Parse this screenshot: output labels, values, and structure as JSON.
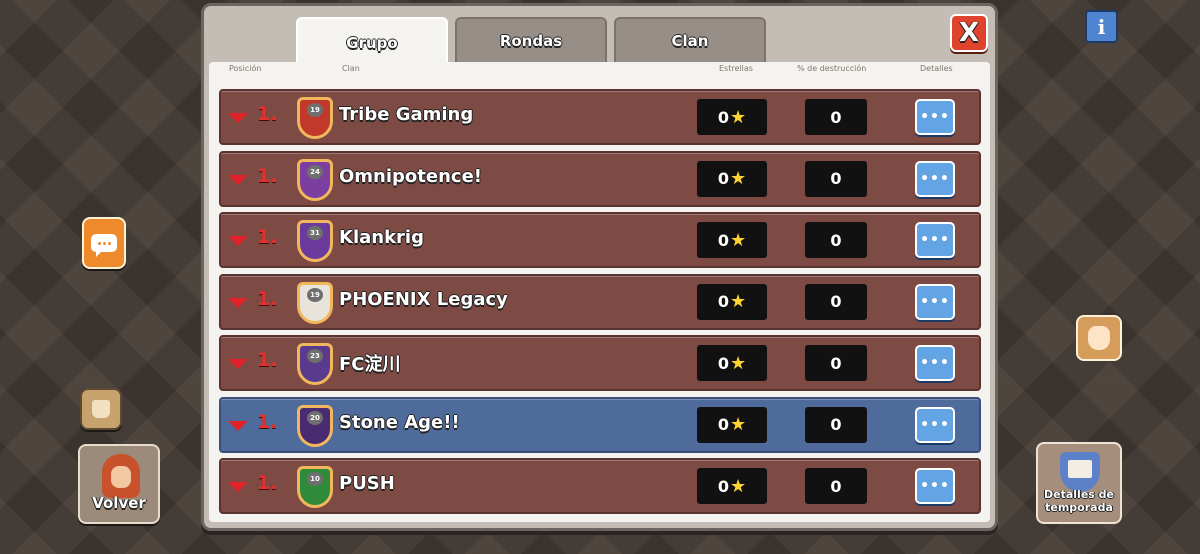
{
  "tabs": [
    {
      "label": "Grupo",
      "active": true
    },
    {
      "label": "Rondas",
      "active": false
    },
    {
      "label": "Clan",
      "active": false
    }
  ],
  "close_label": "X",
  "columns": {
    "position": "Posición",
    "clan": "Clan",
    "stars": "Estrellas",
    "destruction": "% de destrucción",
    "details": "Detalles"
  },
  "rows": [
    {
      "rank": "1.",
      "badge_level": "19",
      "name": "Tribe Gaming",
      "stars": "0",
      "destruction": "0",
      "details": "•••",
      "badge_color": "#c0392b"
    },
    {
      "rank": "1.",
      "badge_level": "24",
      "name": "Omnipotence!",
      "stars": "0",
      "destruction": "0",
      "details": "•••",
      "badge_color": "#7b3fa0"
    },
    {
      "rank": "1.",
      "badge_level": "31",
      "name": "Klankrig",
      "stars": "0",
      "destruction": "0",
      "details": "•••",
      "badge_color": "#6a3a9c"
    },
    {
      "rank": "1.",
      "badge_level": "19",
      "name": "PHOENIX Legacy",
      "stars": "0",
      "destruction": "0",
      "details": "•••",
      "badge_color": "#e8e4dc"
    },
    {
      "rank": "1.",
      "badge_level": "23",
      "name": "FC淀川",
      "stars": "0",
      "destruction": "0",
      "details": "•••",
      "badge_color": "#5a3a8c"
    },
    {
      "rank": "1.",
      "badge_level": "20",
      "name": "Stone Age!!",
      "stars": "0",
      "destruction": "0",
      "details": "•••",
      "badge_color": "#4a2a70",
      "highlight": true
    },
    {
      "rank": "1.",
      "badge_level": "10",
      "name": "PUSH",
      "stars": "0",
      "destruction": "0",
      "details": "•••",
      "badge_color": "#2f8a3a"
    }
  ],
  "side": {
    "back_label": "Volver",
    "season_label": "Detalles de temporada",
    "info_label": "i"
  },
  "colors": {
    "row_bg": "#7e4a44",
    "row_highlight_bg": "#4f6b9c",
    "rank_arrow": "#e2222a",
    "details_button": "#63a4e4",
    "close_button": "#e0432d"
  }
}
